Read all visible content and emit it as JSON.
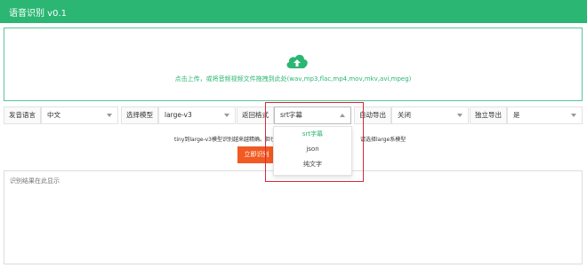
{
  "app": {
    "title": "语音识别 v0.1"
  },
  "upload": {
    "hint": "点击上传，或将音频视频文件拖拽到此处(wav,mp3,flac,mp4,mov,mkv,avi,mpeg)"
  },
  "options": {
    "language": {
      "label": "发音语言",
      "value": "中文"
    },
    "model": {
      "label": "选择模型",
      "value": "large-v3"
    },
    "format": {
      "label": "返回格式",
      "value": "srt字幕",
      "options": [
        "srt字幕",
        "json",
        "纯文字"
      ]
    },
    "auto_export": {
      "label": "自动导出",
      "value": "关闭"
    },
    "separate_export": {
      "label": "独立导出",
      "value": "是"
    }
  },
  "tip": {
    "left": "tiny到large-v3模型识别越来越精确。但也更",
    "right": "请选择large系模型"
  },
  "start_button": {
    "label": "立即识别（"
  },
  "result": {
    "placeholder": "识别结果在此显示"
  },
  "colors": {
    "brand": "#2bb673",
    "accent": "#f15a22",
    "highlight": "#d9283b"
  }
}
